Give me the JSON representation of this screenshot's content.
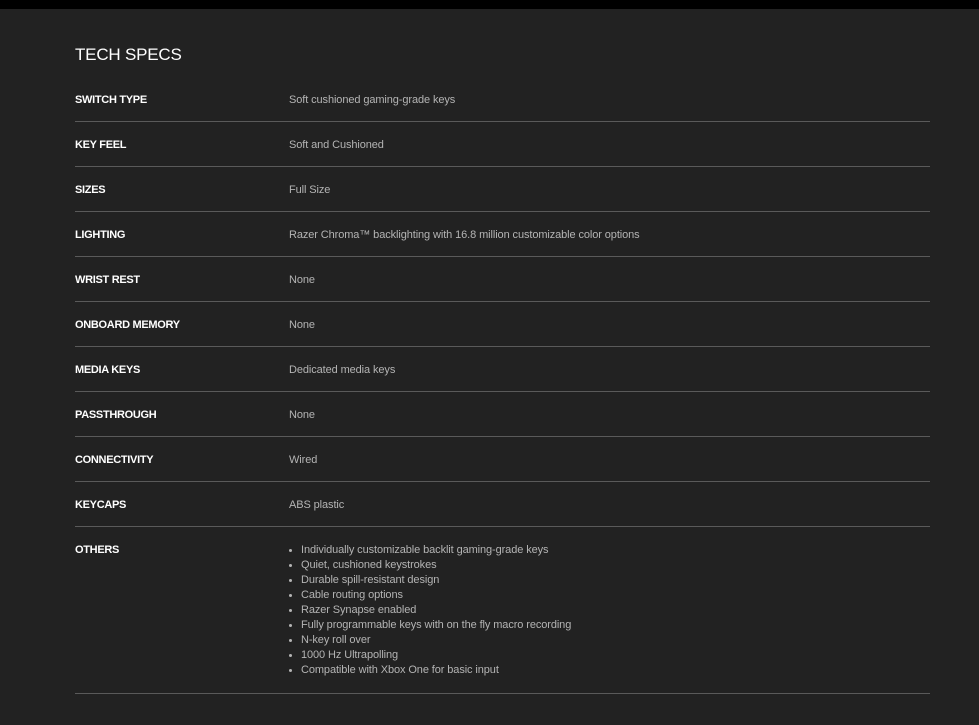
{
  "section": {
    "title": "TECH SPECS"
  },
  "specs": [
    {
      "label": "SWITCH TYPE",
      "value": "Soft cushioned gaming-grade keys"
    },
    {
      "label": "KEY FEEL",
      "value": "Soft and Cushioned"
    },
    {
      "label": "SIZES",
      "value": "Full Size"
    },
    {
      "label": "LIGHTING",
      "value": "Razer Chroma™ backlighting with 16.8 million customizable color options"
    },
    {
      "label": "WRIST REST",
      "value": "None"
    },
    {
      "label": "ONBOARD MEMORY",
      "value": "None"
    },
    {
      "label": "MEDIA KEYS",
      "value": "Dedicated media keys"
    },
    {
      "label": "PASSTHROUGH",
      "value": "None"
    },
    {
      "label": "CONNECTIVITY",
      "value": "Wired"
    },
    {
      "label": "KEYCAPS",
      "value": "ABS plastic"
    }
  ],
  "others": {
    "label": "OTHERS",
    "items": [
      "Individually customizable backlit gaming-grade keys",
      "Quiet, cushioned keystrokes",
      "Durable spill-resistant design",
      "Cable routing options",
      "Razer Synapse enabled",
      "Fully programmable keys with on the fly macro recording",
      "N-key roll over",
      "1000 Hz Ultrapolling",
      "Compatible with Xbox One for basic input"
    ]
  },
  "colors": {
    "background": "#222222",
    "top_bar": "#000000",
    "label_text": "#ffffff",
    "value_text": "#b4b4b4",
    "divider": "#5a5a5a"
  }
}
